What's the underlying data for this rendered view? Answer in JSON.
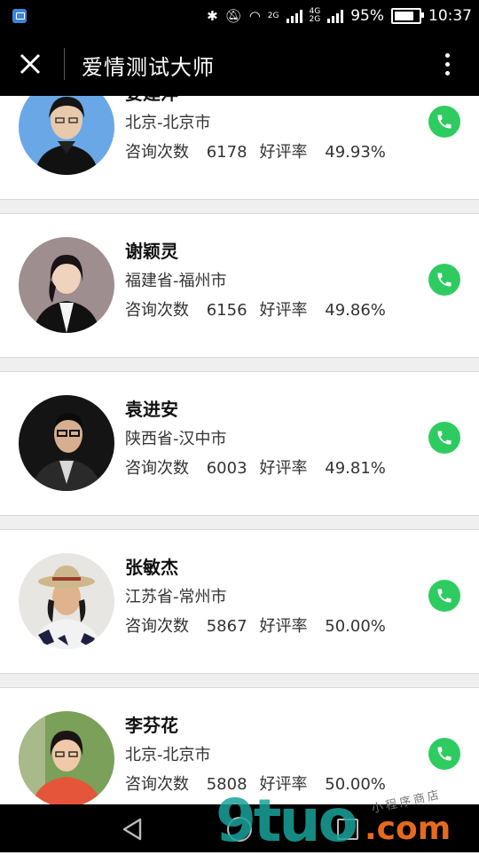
{
  "status_bar": {
    "net_a": "2G",
    "net_b_top": "4G",
    "net_b_bottom": "2G",
    "battery": "95%",
    "battery_level": 0.95,
    "time": "10:37"
  },
  "title_bar": {
    "title": "爱情测试大师"
  },
  "consultants": [
    {
      "name": "姜建萍",
      "region": "北京-北京市",
      "consult_label": "咨询次数",
      "consults": "6178",
      "rating_label": "好评率",
      "rating": "49.93%"
    },
    {
      "name": "谢颖灵",
      "region": "福建省-福州市",
      "consult_label": "咨询次数",
      "consults": "6156",
      "rating_label": "好评率",
      "rating": "49.86%"
    },
    {
      "name": "袁进安",
      "region": "陕西省-汉中市",
      "consult_label": "咨询次数",
      "consults": "6003",
      "rating_label": "好评率",
      "rating": "49.81%"
    },
    {
      "name": "张敏杰",
      "region": "江苏省-常州市",
      "consult_label": "咨询次数",
      "consults": "5867",
      "rating_label": "好评率",
      "rating": "50.00%"
    },
    {
      "name": "李芬花",
      "region": "北京-北京市",
      "consult_label": "咨询次数",
      "consults": "5808",
      "rating_label": "好评率",
      "rating": "50.00%"
    }
  ],
  "watermark": {
    "big": "9tuo",
    "com": ".com",
    "small": "小程序商店"
  },
  "colors": {
    "call_green": "#2ecc60",
    "bar_black": "#000000"
  }
}
